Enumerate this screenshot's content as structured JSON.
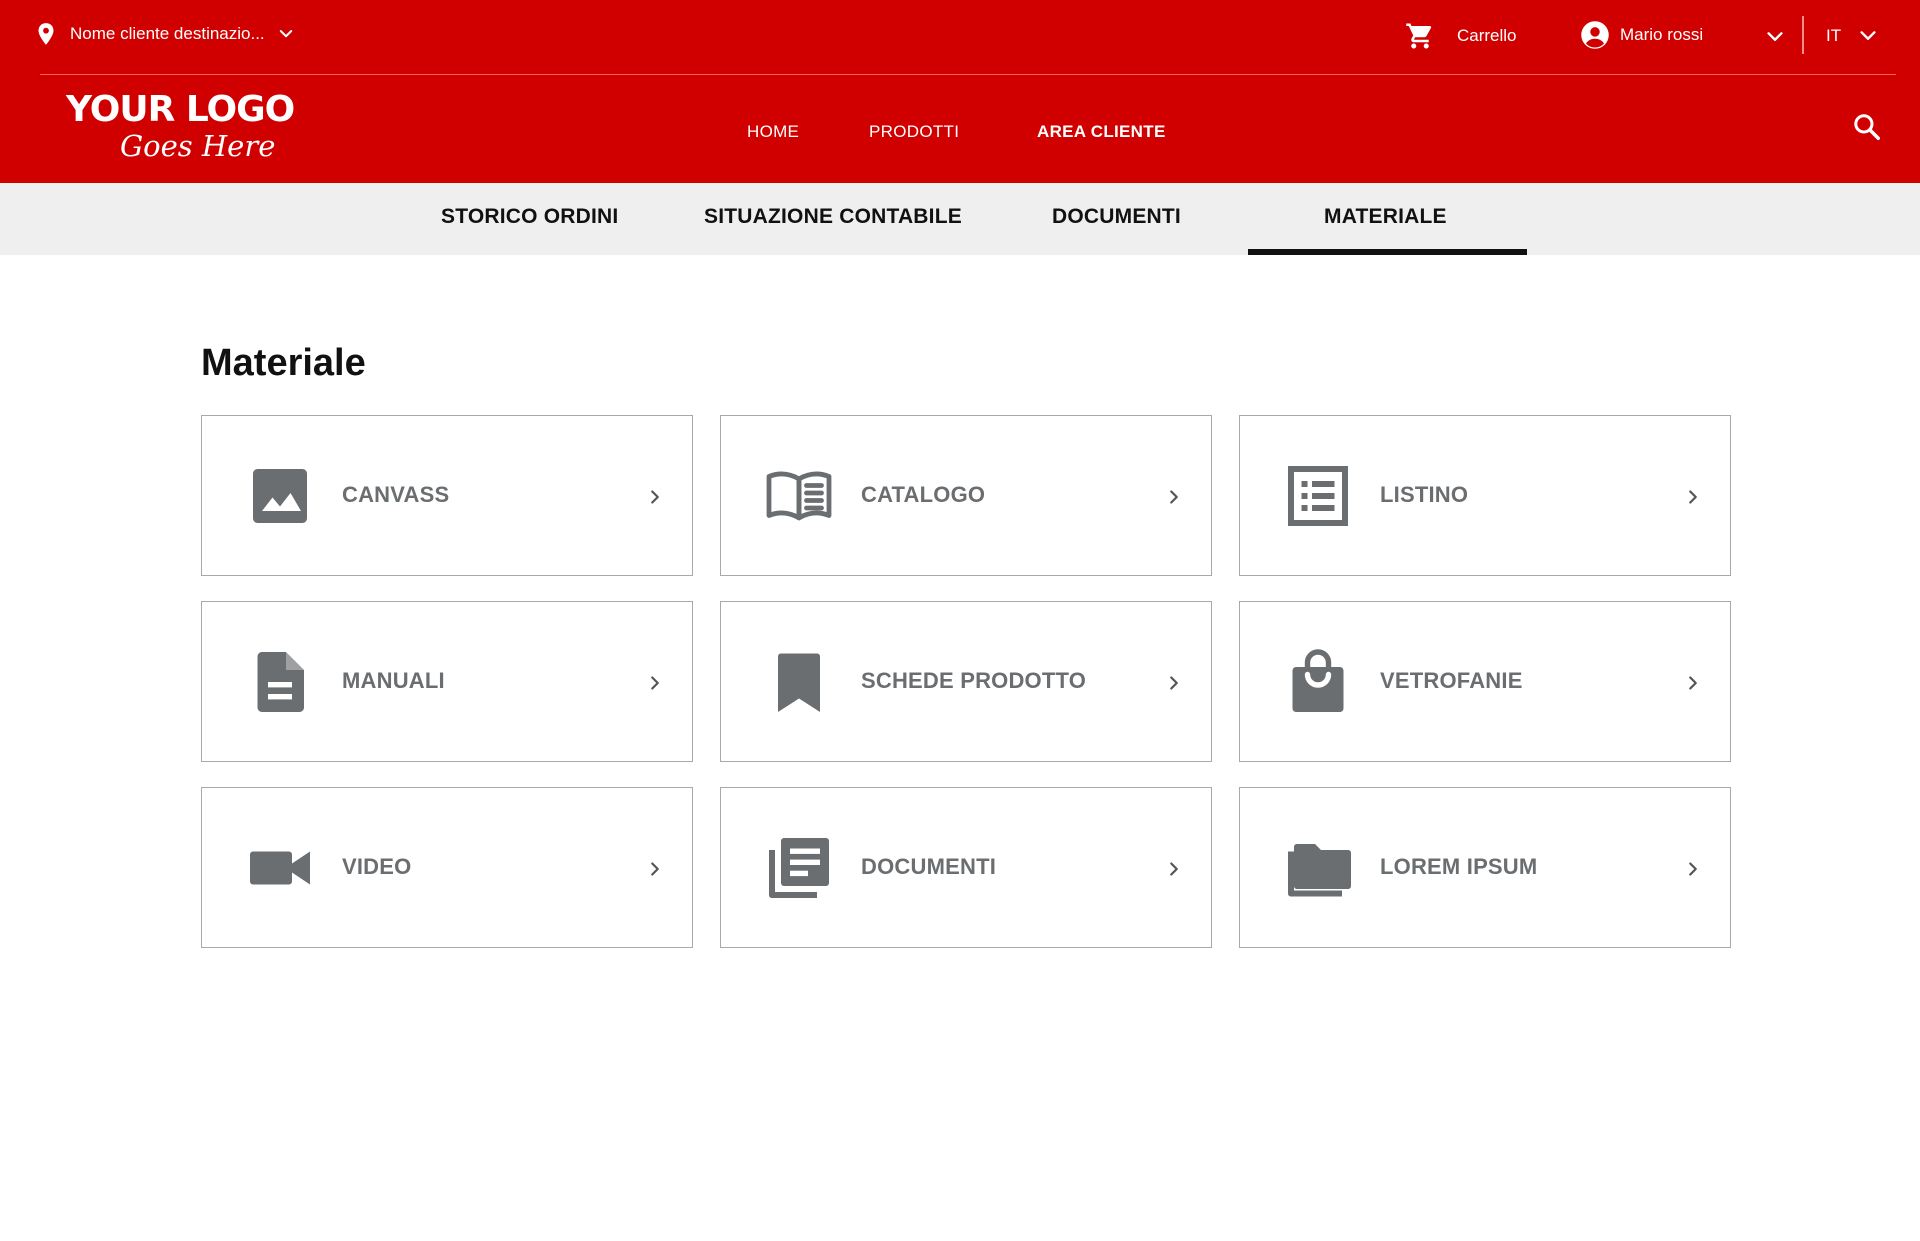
{
  "topbar": {
    "location_label": "Nome cliente destinazio...",
    "cart_label": "Carrello",
    "user_name": "Mario rossi",
    "language": "IT"
  },
  "logo": {
    "line1": "YOUR LOGO",
    "line2": "Goes Here"
  },
  "main_nav": {
    "items": [
      {
        "label": "HOME"
      },
      {
        "label": "PRODOTTI"
      },
      {
        "label": "AREA CLIENTE",
        "active": true
      }
    ]
  },
  "sub_nav": {
    "tabs": [
      {
        "label": "STORICO ORDINI"
      },
      {
        "label": "SITUAZIONE CONTABILE"
      },
      {
        "label": "DOCUMENTI"
      },
      {
        "label": "MATERIALE",
        "active": true
      }
    ]
  },
  "page": {
    "title": "Materiale"
  },
  "cards": [
    {
      "label": "CANVASS",
      "icon": "image-icon"
    },
    {
      "label": "CATALOGO",
      "icon": "book-open-icon"
    },
    {
      "label": "LISTINO",
      "icon": "list-icon"
    },
    {
      "label": "MANUALI",
      "icon": "file-text-icon"
    },
    {
      "label": "SCHEDE PRODOTTO",
      "icon": "bookmark-icon"
    },
    {
      "label": "VETROFANIE",
      "icon": "shopping-bag-icon"
    },
    {
      "label": "VIDEO",
      "icon": "video-camera-icon"
    },
    {
      "label": "DOCUMENTI",
      "icon": "library-books-icon"
    },
    {
      "label": "LOREM IPSUM",
      "icon": "folder-icon"
    }
  ],
  "colors": {
    "brand_red": "#d10000",
    "icon_gray": "#6b6e70",
    "subnav_bg": "#efefef",
    "card_border": "#a9a9a9"
  }
}
